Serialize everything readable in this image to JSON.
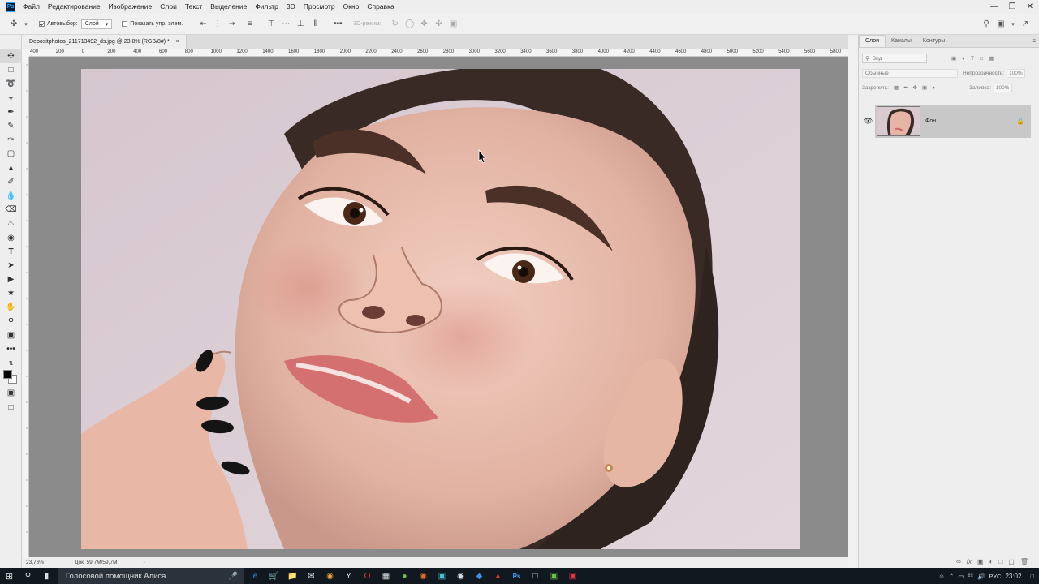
{
  "app": {
    "logo_text": "Ps"
  },
  "menu": [
    "Файл",
    "Редактирование",
    "Изображение",
    "Слои",
    "Текст",
    "Выделение",
    "Фильтр",
    "3D",
    "Просмотр",
    "Окно",
    "Справка"
  ],
  "options_bar": {
    "autoselect_label": "Автовыбор:",
    "autoselect_value": "Слой",
    "show_controls_label": "Показать упр. элем.",
    "mode_3d_label": "3D-режим:"
  },
  "document": {
    "tab_title": "Depositphotos_211713492_ds.jpg @ 23,8% (RGB/8#) *",
    "close_glyph": "×"
  },
  "ruler_h_labels": [
    "400",
    "200",
    "0",
    "200",
    "400",
    "600",
    "800",
    "1000",
    "1200",
    "1400",
    "1600",
    "1800",
    "2000",
    "2200",
    "2400",
    "2600",
    "2800",
    "3000",
    "3200",
    "3400",
    "3600",
    "3800",
    "4000",
    "4200",
    "4400",
    "4600",
    "4800",
    "5000",
    "5200",
    "5400",
    "5600",
    "5800"
  ],
  "status": {
    "zoom": "23,76%",
    "doc_info": "Док: 59,7M/59,7M"
  },
  "layers_panel": {
    "tabs": [
      "Слои",
      "Каналы",
      "Контуры"
    ],
    "filter_placeholder": "Вид",
    "blend_mode": "Обычные",
    "opacity_label": "Непрозрачность:",
    "opacity_value": "100%",
    "lock_label": "Закрепить:",
    "fill_label": "Заливка:",
    "fill_value": "100%",
    "layer_name": "Фон"
  },
  "taskbar": {
    "search_text": "Голосовой помощник Алиса",
    "lang": "РУС",
    "time": "23:02"
  },
  "colors": {
    "accent_ps": "#31a8ff",
    "taskbar": "#121820",
    "canvas_bg": "#8b8b8b"
  }
}
